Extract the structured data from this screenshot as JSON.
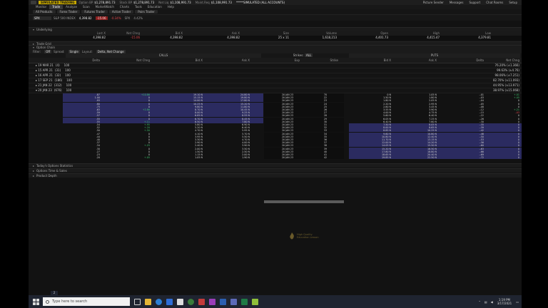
{
  "app": {
    "mode_badge": "SIMULATED TRADING",
    "summary": [
      {
        "label": "Option BP",
        "value": "$1,278,891.73"
      },
      {
        "label": "Stock BP",
        "value": "$1,278,891.73"
      },
      {
        "label": "Net Liq",
        "value": "$1,108,991.73"
      },
      {
        "label": "Maint.Req",
        "value": "$1,108,991.73"
      }
    ],
    "account": "*****SIMULATED (ALL ACCOUNTS)",
    "right_tools": [
      "Picture Sender",
      "Messages",
      "Support",
      "Chat Rooms",
      "Setup"
    ]
  },
  "tabs": [
    "Monitor",
    "Trade",
    "Analyze",
    "Scan",
    "MarketWatch",
    "Charts",
    "Tools",
    "Education",
    "Help"
  ],
  "active_tab": "Trade",
  "subtabs": [
    "All Products",
    "Forex Trader",
    "Futures Trader",
    "Active Trader",
    "Pairs Trader"
  ],
  "symbol_row": {
    "symbol": "SPX",
    "company": "S&P 500 INDEX",
    "last": "4,398.82",
    "change": "-15.06",
    "change_pct": "-0.34%",
    "extra": [
      "SPX",
      "4.42%"
    ]
  },
  "sections": {
    "underlying": "Underlying",
    "trade_grid": "Trade Grid",
    "option_chain": "Option Chain",
    "todays_options_statistics": "Today's Options Statistics",
    "options_time_sales": "Options Time & Sales",
    "product_depth": "Product Depth"
  },
  "underlying": {
    "columns": [
      "Last X",
      "Net Chng",
      "Bid X",
      "Ask X",
      "Size",
      "Volume",
      "Open",
      "High",
      "Low"
    ],
    "values": [
      "4,398.82",
      "-15.06",
      "4,398.82",
      "4,398.82",
      "25 x 11",
      "1,618,213",
      "4,401.73",
      "4,415.47",
      "4,379.81"
    ]
  },
  "option_chain_bar": {
    "filter_label": "Filter:",
    "filter_value": "Off",
    "spread_label": "Spread:",
    "spread_value": "Single",
    "layout_label": "Layout:",
    "layout_value": "Delta, Net Change"
  },
  "strikes": {
    "label": "Strikes:",
    "value": "ALL"
  },
  "calls_label": "CALLS",
  "puts_label": "PUTS",
  "column_headers": {
    "calls": [
      "Delta",
      "Net Chng",
      "Bid X",
      "Ask X"
    ],
    "middle": [
      "Exp",
      "Strike"
    ],
    "puts": [
      "Bid X",
      "Ask X",
      "Delta",
      "Net Chng"
    ]
  },
  "expirations": [
    {
      "label": "19 MAR 21",
      "days": "(4)",
      "count": "100",
      "pct": "76.20% (±1.366)"
    },
    {
      "label": "15 APR 21",
      "days": "(31)",
      "count": "100",
      "pct": "99.63% (±4.76)"
    },
    {
      "label": "16 APR 21",
      "days": "(32)",
      "count": "100",
      "pct": "98.06% (±7.251)"
    },
    {
      "label": "17 SEP 21",
      "days": "(186)",
      "count": "100",
      "pct": "82.70% (±11.093)"
    },
    {
      "label": "21 JAN 22",
      "days": "(312)",
      "count": "100",
      "pct": "44.95% (±13.971)"
    },
    {
      "label": "20 JAN 23",
      "days": "(676)",
      "count": "100",
      "pct": "38.97% (±15.068)"
    }
  ],
  "chain_rows": [
    {
      "cd": ".87",
      "cn": "+10.86",
      "cb": "19.10 N",
      "ca": "24.80 N",
      "exp": "20 JAN 23",
      "k": "70",
      "pb": "0 N",
      "pa": "1.05 N",
      "pd": "-.01",
      "pn": "+.01"
    },
    {
      "cd": "1.00",
      "cn": "0",
      "cb": "15.15 N",
      "ca": "19.80 N",
      "exp": "20 JAN 23",
      "k": "22",
      "pb": "1.50 N",
      "pa": "1.80 N",
      "pd": "-.03",
      "pn": "+.05"
    },
    {
      "cd": ".93",
      "cn": "0",
      "cb": "14.00 N",
      "ca": "17.80 N",
      "exp": "20 JAN 23",
      "k": "23",
      "pb": "1.80 N",
      "pa": "2.05 N",
      "pd": "-.04",
      "pn": "0"
    },
    {
      "cd": ".80",
      "cn": "0",
      "cb": "10.25 N",
      "ca": "15.20 N",
      "exp": "20 JAN 23",
      "k": "24",
      "pb": "2.20 N",
      "pa": "2.95 N",
      "pd": "-.05",
      "pn": "0"
    },
    {
      "cd": ".75",
      "cn": "0",
      "cb": "9.80 N",
      "ca": "11.80 N",
      "exp": "20 JAN 23",
      "k": "25",
      "pb": "2.80 N",
      "pa": "3.45 N",
      "pd": "-.08",
      "pn": "0"
    },
    {
      "cd": ".63",
      "cn": "+2.86",
      "cb": "8.70 N",
      "ca": "10.45 N",
      "exp": "20 JAN 23",
      "k": "26",
      "pb": "3.55 N",
      "pa": "3.90 N",
      "pd": "-.12",
      "pn": "+.21"
    },
    {
      "cd": ".59",
      "cn": "0",
      "cb": "8.00 N",
      "ca": "9.25 N",
      "exp": "20 JAN 23",
      "k": "27",
      "pb": "4.00 N",
      "pa": "4.75 N",
      "pd": "-.15",
      "pn": "-.03"
    },
    {
      "cd": ".57",
      "cn": "0",
      "cb": "6.85 N",
      "ca": "8.55 N",
      "exp": "20 JAN 23",
      "k": "28",
      "pb": "5.60 N",
      "pa": "6.40 N",
      "pd": "-.22",
      "pn": "0"
    },
    {
      "cd": ".55",
      "cn": "0",
      "cb": "6.70 N",
      "ca": "8.45 N",
      "exp": "20 JAN 23",
      "k": "29",
      "pb": "6.05 N",
      "pa": "7.25 N",
      "pd": "-.26",
      "pn": "0"
    },
    {
      "cd": ".55",
      "cn": "+.11",
      "cb": "6.50 N",
      "ca": "7.80 N",
      "exp": "20 JAN 23",
      "k": "30",
      "pb": "6.40 N",
      "pa": "7.60 N",
      "pd": "-.30",
      "pn": "0"
    },
    {
      "cd": ".54",
      "cn": "+.95",
      "cb": "5.80 N",
      "ca": "6.90 N",
      "exp": "20 JAN 23",
      "k": "31",
      "pb": "7.50 N",
      "pa": "8.05 N",
      "pd": "-.35",
      "pn": "0"
    },
    {
      "cd": ".52",
      "cn": "+.20",
      "cb": "5.20 N",
      "ca": "6.40 N",
      "exp": "20 JAN 23",
      "k": "32",
      "pb": "8.00 N",
      "pa": "8.65 N",
      "pd": "-.39",
      "pn": "0"
    },
    {
      "cd": ".50",
      "cn": "+.50",
      "cb": "4.70 N",
      "ca": "5.95 N",
      "exp": "20 JAN 23",
      "k": "33",
      "pb": "8.85 N",
      "pa": "10.25 N",
      "pd": "-.42",
      "pn": "0"
    },
    {
      "cd": ".47",
      "cn": "0",
      "cb": "4.10 N",
      "ca": "5.70 N",
      "exp": "20 JAN 23",
      "k": "34",
      "pb": "9.60 N",
      "pa": "10.80 N",
      "pd": "-.46",
      "pn": "0"
    },
    {
      "cd": ".44",
      "cn": "0",
      "cb": "3.95 N",
      "ca": "5.50 N",
      "exp": "20 JAN 23",
      "k": "35",
      "pb": "10.80 N",
      "pa": "12.40 N",
      "pd": "-.50",
      "pn": "0"
    },
    {
      "cd": ".40",
      "cn": "0",
      "cb": "3.30 N",
      "ca": "4.70 N",
      "exp": "20 JAN 23",
      "k": "36",
      "pb": "11.70 N",
      "pa": "13.15 N",
      "pd": "-.53",
      "pn": "0"
    },
    {
      "cd": ".37",
      "cn": "0",
      "cb": "2.90 N",
      "ca": "4.00 N",
      "exp": "20 JAN 23",
      "k": "37",
      "pb": "12.00 N",
      "pa": "14.20 N",
      "pd": "-.56",
      "pn": "0"
    },
    {
      "cd": ".34",
      "cn": "+.25",
      "cb": "2.40 N",
      "ca": "3.90 N",
      "exp": "20 JAN 23",
      "k": "38",
      "pb": "14.05 N",
      "pa": "15.50 N",
      "pd": "-.60",
      "pn": "0"
    },
    {
      "cd": ".30",
      "cn": "0",
      "cb": "2.00 N",
      "ca": "3.50 N",
      "exp": "20 JAN 23",
      "k": "39",
      "pb": "15.20 N",
      "pa": "16.50 N",
      "pd": "-.63",
      "pn": "0"
    },
    {
      "cd": ".27",
      "cn": "0",
      "cb": "1.50 N",
      "ca": "2.50 N",
      "exp": "20 JAN 23",
      "k": "40",
      "pb": "17.80 N",
      "pa": "18.80 N",
      "pd": "-.66",
      "pn": "0"
    },
    {
      "cd": ".23",
      "cn": "0",
      "cb": "1.15 N",
      "ca": "2.00 N",
      "exp": "20 JAN 23",
      "k": "41",
      "pb": "18.65 N",
      "pa": "20.40 N",
      "pd": "-.69",
      "pn": "0"
    },
    {
      "cd": ".20",
      "cn": "+.05",
      "cb": "1.05 N",
      "ca": "1.90 N",
      "exp": "20 JAN 23",
      "k": "42",
      "pb": "19.85 N",
      "pa": "22.50 N",
      "pd": "-.72",
      "pn": "0"
    }
  ],
  "watermark": {
    "line1": "High Quality",
    "line2": "Education Lesson"
  },
  "taskbar": {
    "search_placeholder": "Type here to search",
    "time": "1:19 PM",
    "date": "3/17/2021",
    "tag": "2"
  },
  "colors": {
    "itm_fill": "#2b2b60",
    "accent_yellow": "#c8a900",
    "positive": "#3ec46d",
    "negative": "#e0474c"
  }
}
